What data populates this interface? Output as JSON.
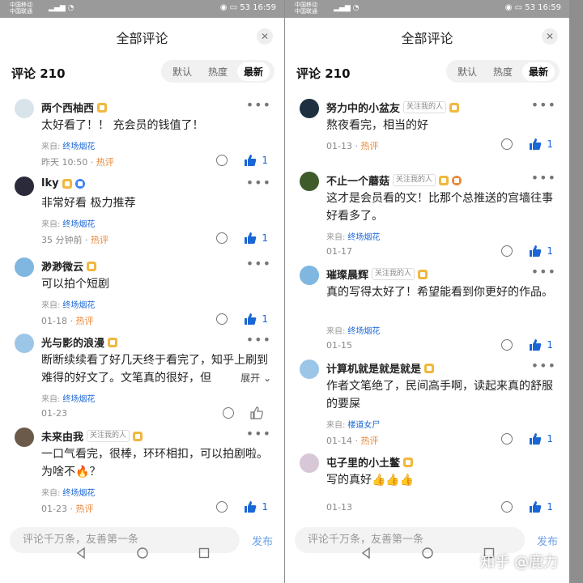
{
  "status": {
    "carrier1": "中国移动",
    "carrier2": "中国联通",
    "battery": "53",
    "time": "16:59"
  },
  "header": {
    "title": "全部评论",
    "close_icon": "close-icon"
  },
  "count_label": "评论 210",
  "sort_tabs": [
    {
      "label": "默认"
    },
    {
      "label": "热度"
    },
    {
      "label": "最新",
      "active": true
    }
  ],
  "left": {
    "comments": [
      {
        "name": "两个西柚西",
        "text": "太好看了！！ 充会员的钱值了！",
        "source_prefix": "来自:",
        "source": "终场烟花",
        "time": "昨天 10:50",
        "sep": " · ",
        "hot": "热评",
        "likes": "1"
      },
      {
        "name": "lky",
        "text": "非常好看 极力推荐",
        "source_prefix": "来自:",
        "source": "终场烟花",
        "time": "35 分钟前",
        "sep": " · ",
        "hot": "热评",
        "likes": "1"
      },
      {
        "name": "渺渺微云",
        "text": "可以拍个短剧",
        "source_prefix": "来自:",
        "source": "终场烟花",
        "time": "01-18",
        "sep": " · ",
        "hot": "热评",
        "likes": "1"
      },
      {
        "name": "光与影的浪漫",
        "text": "断断续续看了好几天终于看完了，知乎上刷到难得的好文了。文笔真的很好，但",
        "expand": "展开",
        "source_prefix": "来自:",
        "source": "终场烟花",
        "time": "01-23"
      },
      {
        "name": "未来由我",
        "follow": "关注我的人",
        "text": "一口气看完，很棒，环环相扣，可以拍剧啦。为啥不🔥？",
        "source_prefix": "来自:",
        "source": "终场烟花",
        "time": "01-23",
        "sep": " · ",
        "hot": "热评",
        "likes": "1"
      }
    ]
  },
  "right": {
    "comments": [
      {
        "name": "努力中的小盆友",
        "follow": "关注我的人",
        "text": "熬夜看完，相当的好",
        "time": "01-13",
        "sep": " · ",
        "hot": "热评",
        "likes": "1"
      },
      {
        "name": "不止一个蘑菇",
        "follow": "关注我的人",
        "text": "这才是会员看的文！比那个总推送的宫墙往事好看多了。",
        "source_prefix": "来自:",
        "source": "终场烟花",
        "time": "01-17",
        "likes": "1"
      },
      {
        "name": "璀璨晨辉",
        "follow": "关注我的人",
        "text": "真的写得太好了！希望能看到你更好的作品。",
        "source_prefix": "来自:",
        "source": "终场烟花",
        "time": "01-15",
        "likes": "1"
      },
      {
        "name": "计算机就是就是就是",
        "text": "作者文笔绝了，民间高手啊，读起来真的舒服的要屎",
        "source_prefix": "来自:",
        "source": "楼道女尸",
        "time": "01-14",
        "sep": " · ",
        "hot": "热评",
        "likes": "1"
      },
      {
        "name": "屯子里的小土鳖",
        "text": "写的真好👍👍👍",
        "time": "01-13",
        "likes": "1"
      }
    ]
  },
  "bottom": {
    "input_placeholder": "评论千万条，友善第一条",
    "publish": "发布"
  },
  "watermark": "知乎 @鹿力",
  "colors": {
    "accent": "#1a66d6",
    "hot": "#e8883a"
  }
}
